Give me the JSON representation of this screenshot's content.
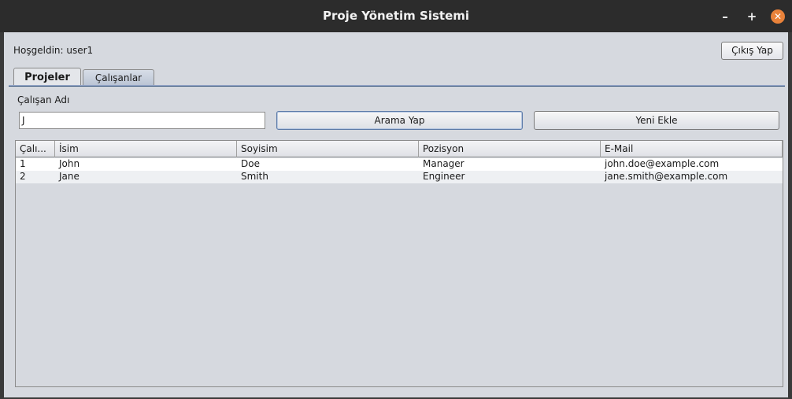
{
  "window": {
    "title": "Proje Yönetim Sistemi",
    "minimize": "–",
    "maximize": "+",
    "close": "✕"
  },
  "header": {
    "welcome": "Hoşgeldin: user1",
    "logout_label": "Çıkış Yap"
  },
  "tabs": [
    {
      "label": "Projeler",
      "active": true
    },
    {
      "label": "Çalışanlar",
      "active": false
    }
  ],
  "search": {
    "label": "Çalışan Adı",
    "value": "J",
    "search_button": "Arama Yap",
    "add_button": "Yeni Ekle"
  },
  "table": {
    "columns": [
      "Çalı...",
      "İsim",
      "Soyisim",
      "Pozisyon",
      "E-Mail"
    ],
    "rows": [
      [
        "1",
        "John",
        "Doe",
        "Manager",
        "john.doe@example.com"
      ],
      [
        "2",
        "Jane",
        "Smith",
        "Engineer",
        "jane.smith@example.com"
      ]
    ]
  }
}
